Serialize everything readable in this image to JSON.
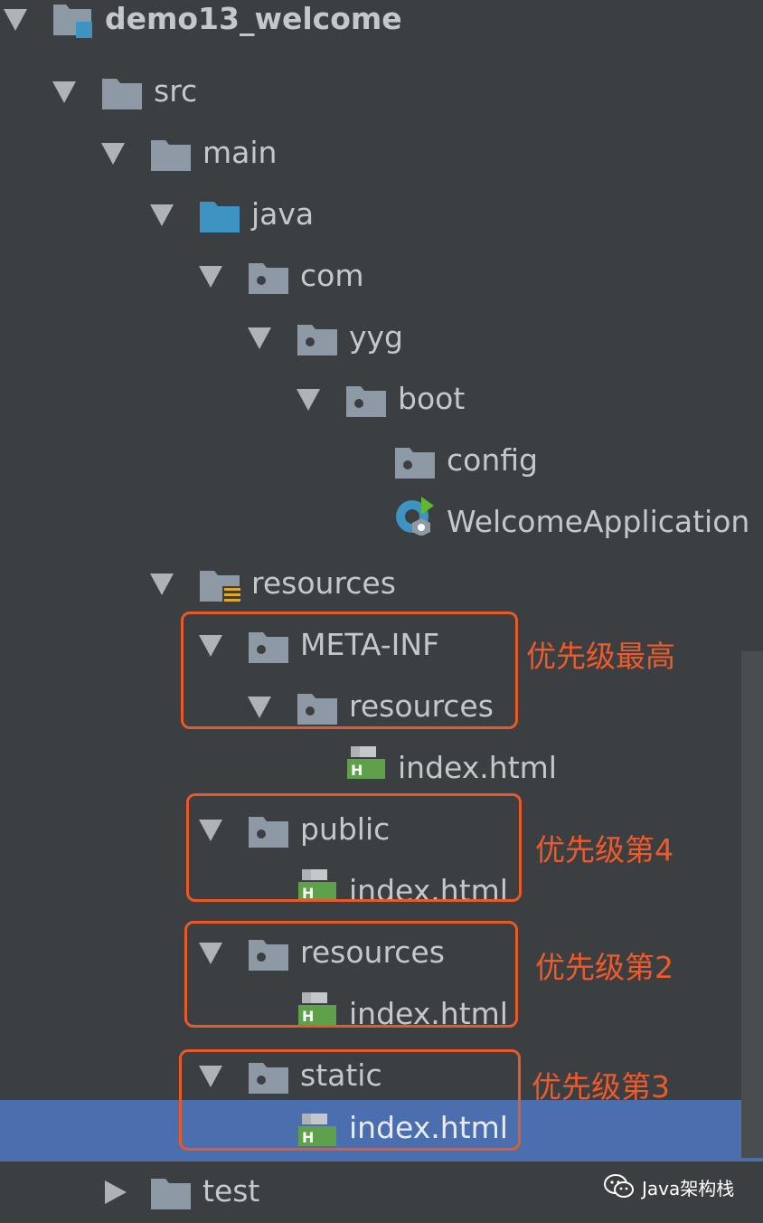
{
  "tree": {
    "root": {
      "label": "demo13_welcome"
    },
    "src": {
      "label": "src"
    },
    "main": {
      "label": "main"
    },
    "java": {
      "label": "java"
    },
    "com": {
      "label": "com"
    },
    "yyg": {
      "label": "yyg"
    },
    "boot": {
      "label": "boot"
    },
    "config": {
      "label": "config"
    },
    "welcome_app": {
      "label": "WelcomeApplication"
    },
    "resources": {
      "label": "resources"
    },
    "meta_inf": {
      "label": "META-INF"
    },
    "meta_resources": {
      "label": "resources"
    },
    "meta_index": {
      "label": "index.html"
    },
    "public": {
      "label": "public"
    },
    "public_index": {
      "label": "index.html"
    },
    "res_dir": {
      "label": "resources"
    },
    "res_index": {
      "label": "index.html"
    },
    "static": {
      "label": "static"
    },
    "static_index": {
      "label": "index.html"
    },
    "test": {
      "label": "test"
    }
  },
  "annotations": {
    "meta": "优先级最高",
    "public": "优先级第4",
    "resources": "优先级第2",
    "static": "优先级第3"
  },
  "watermark": {
    "text": "Java架构栈"
  },
  "colors": {
    "background": "#3c3f41",
    "selection": "#4b6eaf",
    "annotation": "#e8592a",
    "folder": "#8d9aa5",
    "source_folder": "#3d93c2",
    "html_icon": "#5fa14a"
  },
  "icons": {
    "folder": "folder-icon",
    "package": "package-icon",
    "source_folder": "source-folder-icon",
    "resources_folder": "resources-folder-icon",
    "spring_boot_app": "spring-boot-run-icon",
    "html_file": "html-file-icon",
    "module": "module-icon"
  }
}
